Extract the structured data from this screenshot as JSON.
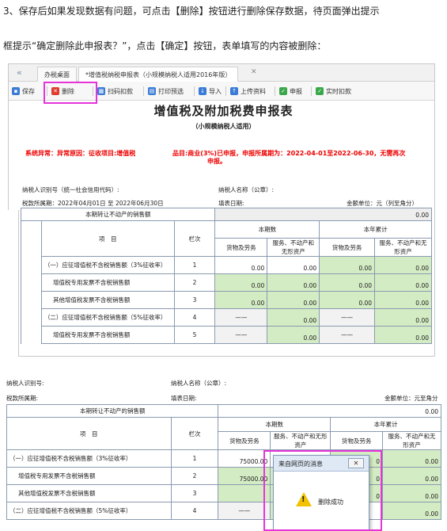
{
  "instructions": {
    "line1": "3、保存后如果发现数据有问题，可点击【删除】按钮进行删除保存数据，待页面弹出提示",
    "line2": "框提示“确定删除此申报表？”，点击【确定】按钮，表单填写的内容被删除："
  },
  "tabs": {
    "back": "«",
    "home": "办税桌面",
    "form": "*增值税纳税申报表（小规模纳税人适用2016年版）",
    "close": "✕"
  },
  "toolbar": {
    "save": "保存",
    "delete": "删除",
    "scan": "扫码扣款",
    "print": "打印预选",
    "import": "导入",
    "upload": "上传资料",
    "declare": "申报",
    "realtime": "实时扣款"
  },
  "form": {
    "title": "增值税及附加税费申报表",
    "subtitle": "（小规模纳税人适用）",
    "error_left": "系统异常：异常原因：征收项目:增值税",
    "error_right": "品目:商业(3%)已申报，申报所属期为：2022-04-01至2022-06-30，无需再次",
    "error_right2": "申报。",
    "taxpayer_id": "纳税人识别号（统一社会信用代码）:",
    "taxpayer_name": "纳税人名称（公章）:",
    "period": "税款所属期：2022年04月01日 至 2022年06月30日",
    "fill_date": "填表日期:",
    "unit": "金额单位：元（列至角分）"
  },
  "table1": {
    "row0_label": "本期转让不动产的销售额",
    "row0_value": "0.00",
    "col_item": "项　目",
    "col_seq": "栏次",
    "col_period": "本期数",
    "col_year": "本年累计",
    "col_goods": "货物及劳务",
    "col_service": "服务、不动产和无形资产",
    "rows": [
      {
        "label": "（一）应征增值税不含税销售额（3%征收率）",
        "seq": "1",
        "v1": "0.00",
        "v2": "0.00",
        "v3": "0.00",
        "v4": "0.00"
      },
      {
        "label": "增值税专用发票不含税销售额",
        "seq": "2",
        "v1": "0.00",
        "v2": "0.00",
        "v3": "0.00",
        "v4": "0.00"
      },
      {
        "label": "其他增值税发票不含税销售额",
        "seq": "3",
        "v1": "0.00",
        "v2": "0.00",
        "v3": "0.00",
        "v4": "0.00"
      },
      {
        "label": "（二）应征增值税不含税销售额（5%征收率）",
        "seq": "4",
        "v1": "——",
        "v2": "0.00",
        "v3": "——",
        "v4": "0.00"
      },
      {
        "label": "增值税专用发票不含税销售额",
        "seq": "5",
        "v1": "——",
        "v2": "0.00",
        "v3": "——",
        "v4": "0.00"
      }
    ]
  },
  "form2": {
    "taxpayer_id": "纳税人识别号:",
    "taxpayer_name": "纳税人名称（公章）:",
    "period": "税款所属期:",
    "fill_date": "填表日期:",
    "unit": "金额单位：元至角分"
  },
  "table2": {
    "row0_label": "本期转让不动产的销售额",
    "row0_value": "0.00",
    "col_item": "项　目",
    "col_seq": "栏次",
    "col_period": "本期数",
    "col_year": "本年累计",
    "col_goods": "货物及劳务",
    "col_service": "服务、不动产和无形资产",
    "rows": [
      {
        "label": "（一）应征增值税不含税销售额（3%征收率）",
        "seq": "1",
        "v1": "75000.00",
        "v2": "",
        "v3": "0",
        "v4": "0.00"
      },
      {
        "label": "增值税专用发票不含税销售额",
        "seq": "2",
        "v1": "75000.00",
        "v2": "",
        "v3": "0",
        "v4": "0.00"
      },
      {
        "label": "其他增值税发票不含税销售额",
        "seq": "3",
        "v1": "",
        "v2": "",
        "v3": "0",
        "v4": "0.00"
      },
      {
        "label": "（二）应征增值税不含税销售额（5%征收率）",
        "seq": "4",
        "v1": "——",
        "v2": "",
        "v3": "",
        "v4": "0.00"
      }
    ]
  },
  "dialog": {
    "title": "来自网页的消息",
    "close": "✕",
    "message": "删除成功"
  },
  "colors": {
    "highlight": "#e535d9",
    "input_green": "#d4ecc4",
    "error_red": "#ee0000"
  }
}
